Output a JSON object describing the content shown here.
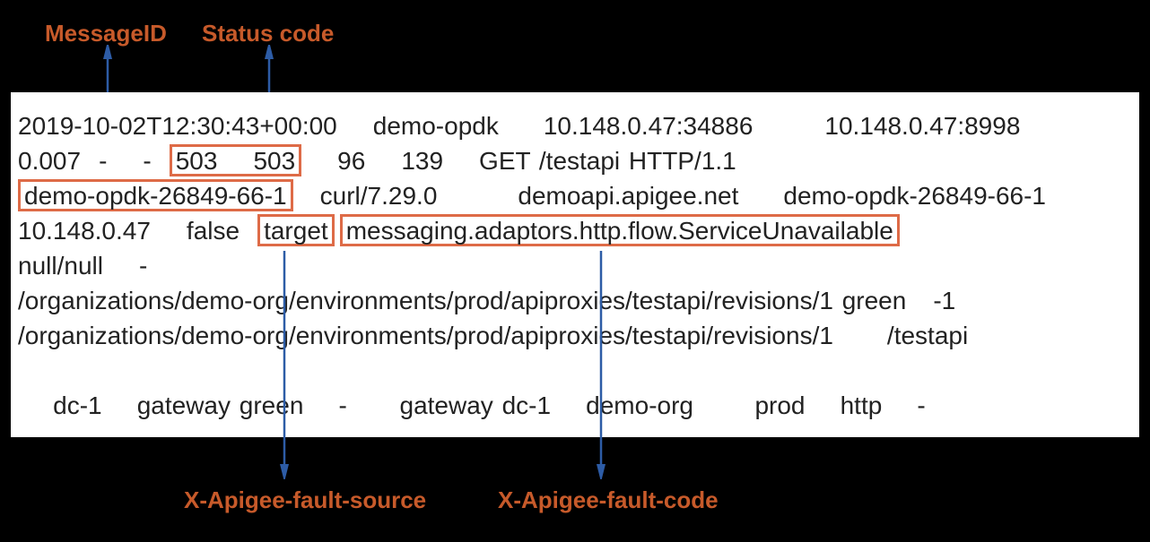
{
  "labels": {
    "messageId": "MessageID",
    "statusCode": "Status code",
    "faultSource": "X-Apigee-fault-source",
    "faultCode": "X-Apigee-fault-code"
  },
  "log": {
    "timestamp": "2019-10-02T12:30:43+00:00",
    "org": "demo-opdk",
    "clientAddr": "10.148.0.47:34886",
    "serverAddr": "10.148.0.47:8998",
    "elapsedSec": "0.007",
    "dash1": "-",
    "dash2": "-",
    "status1": "503",
    "status2": "503",
    "bytesSent": "96",
    "bytesRecv": "139",
    "request": "GET /testapi HTTP/1.1",
    "messageId": "demo-opdk-26849-66-1",
    "userAgent": "curl/7.29.0",
    "host": "demoapi.apigee.net",
    "messageIdRepeat": "demo-opdk-26849-66-1",
    "ip": "10.148.0.47",
    "secure": "false",
    "faultSource": "target",
    "faultCode": "messaging.adaptors.http.flow.ServiceUnavailable",
    "nullnull": "null/null",
    "dash3": "-",
    "path1": "/organizations/demo-org/environments/prod/apiproxies/testapi/revisions/1 green",
    "neg1": "-1",
    "path2": "/organizations/demo-org/environments/prod/apiproxies/testapi/revisions/1",
    "basepath": "/testapi",
    "tail": "dc-1    gateway green    -      gateway dc-1    demo-org       prod    http    -"
  }
}
